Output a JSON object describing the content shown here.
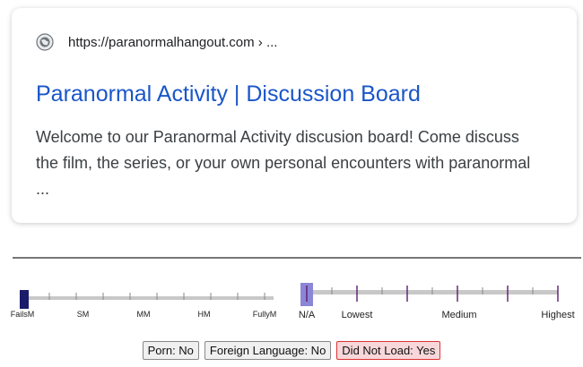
{
  "result": {
    "url": "https://paranormalhangout.com › ...",
    "title": "Paranormal Activity | Discussion Board",
    "snippet": "Welcome to our Paranormal Activity discusion board! Come discuss the film, the series, or your own personal encounters with paranormal ...",
    "globe_icon": "globe-icon"
  },
  "rating_scale": {
    "labels": [
      "FailsM",
      "SM",
      "MM",
      "HM",
      "FullyM"
    ],
    "selected_index": 0,
    "marker_color": "#1b1b6b"
  },
  "relevance_scale": {
    "labels": [
      "N/A",
      "Lowest",
      "Medium",
      "Highest"
    ],
    "selected_label": "N/A",
    "marker_color": "#8b86d6",
    "tick_color": "#5b1c6e"
  },
  "tags": [
    {
      "label": "Porn: No",
      "alert": false
    },
    {
      "label": "Foreign Language: No",
      "alert": false
    },
    {
      "label": "Did Not Load: Yes",
      "alert": true
    }
  ]
}
